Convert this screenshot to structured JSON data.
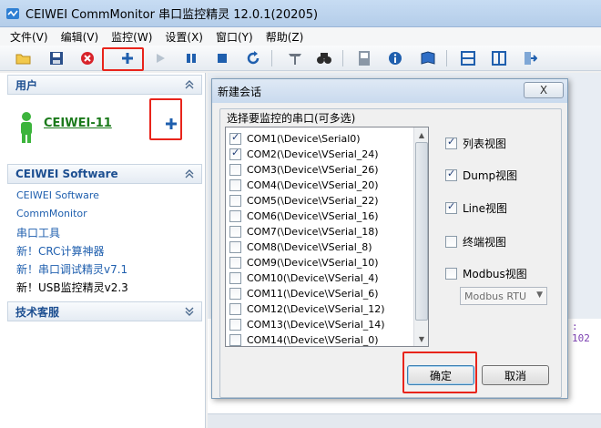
{
  "window": {
    "title": "CEIWEI CommMonitor 串口监控精灵 12.0.1(20205)",
    "menus": [
      "文件(V)",
      "编辑(V)",
      "监控(W)",
      "设置(X)",
      "窗口(Y)",
      "帮助(Z)"
    ]
  },
  "toolbar": {
    "buttons": [
      "open-folder",
      "save",
      "stop-red",
      "add-session",
      "play",
      "pause",
      "stop",
      "refresh",
      "clear",
      "find",
      "save-port",
      "info",
      "book",
      "layout-h",
      "layout-v",
      "exit"
    ]
  },
  "left": {
    "users_header": "用户",
    "user_name": "CEIWEI-11",
    "software_header": "CEIWEI Software",
    "links": [
      "CEIWEI Software",
      "CommMonitor",
      "串口工具",
      "新！CRC计算神器",
      "新！串口调试精灵v7.1",
      "新！USB监控精灵v2.3"
    ],
    "support_header": "技术客服"
  },
  "background": {
    "code_fragment": ": 102"
  },
  "dialog": {
    "title": "新建会话",
    "group_label": "选择要监控的串口(可多选)",
    "ports": [
      {
        "label": "COM1(\\Device\\Serial0)",
        "checked": true
      },
      {
        "label": "COM2(\\Device\\VSerial_24)",
        "checked": true
      },
      {
        "label": "COM3(\\Device\\VSerial_26)",
        "checked": false
      },
      {
        "label": "COM4(\\Device\\VSerial_20)",
        "checked": false
      },
      {
        "label": "COM5(\\Device\\VSerial_22)",
        "checked": false
      },
      {
        "label": "COM6(\\Device\\VSerial_16)",
        "checked": false
      },
      {
        "label": "COM7(\\Device\\VSerial_18)",
        "checked": false
      },
      {
        "label": "COM8(\\Device\\VSerial_8)",
        "checked": false
      },
      {
        "label": "COM9(\\Device\\VSerial_10)",
        "checked": false
      },
      {
        "label": "COM10(\\Device\\VSerial_4)",
        "checked": false
      },
      {
        "label": "COM11(\\Device\\VSerial_6)",
        "checked": false
      },
      {
        "label": "COM12(\\Device\\VSerial_12)",
        "checked": false
      },
      {
        "label": "COM13(\\Device\\VSerial_14)",
        "checked": false
      },
      {
        "label": "COM14(\\Device\\VSerial_0)",
        "checked": false
      }
    ],
    "views": [
      {
        "label": "列表视图",
        "checked": true
      },
      {
        "label": "Dump视图",
        "checked": true
      },
      {
        "label": "Line视图",
        "checked": true
      },
      {
        "label": "终端视图",
        "checked": false
      },
      {
        "label": "Modbus视图",
        "checked": false
      }
    ],
    "modbus_mode": "Modbus RTU",
    "ok_label": "确定",
    "cancel_label": "取消",
    "close_glyph": "X"
  },
  "colors": {
    "highlight": "#e8241b",
    "link": "#1f5fae",
    "user_green": "#1b7a1b"
  }
}
